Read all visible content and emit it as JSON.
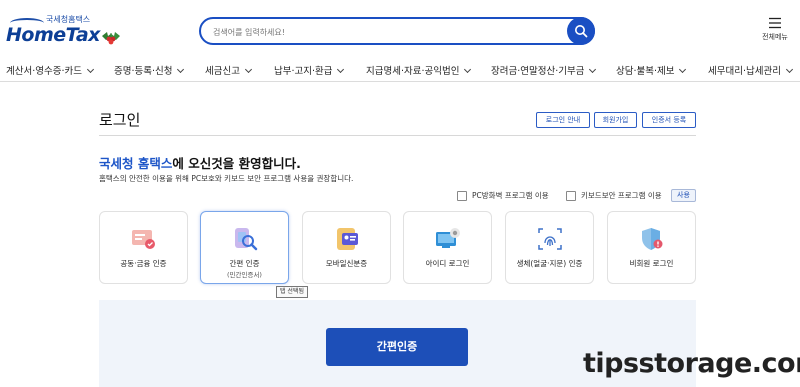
{
  "header": {
    "logo_sub": "국세청홈택스",
    "logo_main": "HomeTax",
    "search_placeholder": "검색어를 입력하세요!",
    "menu_label": "전체메뉴"
  },
  "nav": {
    "items": [
      {
        "label": "계산서·영수증·카드"
      },
      {
        "label": "증명·등록·신청"
      },
      {
        "label": "세금신고"
      },
      {
        "label": "납부·고지·환급"
      },
      {
        "label": "지급명세·자료·공익법인"
      },
      {
        "label": "장려금·연말정산·기부금"
      },
      {
        "label": "상담·불복·제보"
      },
      {
        "label": "세무대리·납세관리"
      }
    ]
  },
  "main": {
    "title": "로그인",
    "top_buttons": [
      {
        "label": "로그인 안내"
      },
      {
        "label": "회원가입"
      },
      {
        "label": "인증서 등록"
      }
    ],
    "welcome_highlight": "국세청 홈택스",
    "welcome_rest": "에 오신것을 환영합니다.",
    "welcome_sub": "홈택스의 안전한 이용을 위해 PC보호와 키보드 보안 프로그램 사용을 권장합니다.",
    "options": [
      {
        "label": "PC방화벽 프로그램 이용"
      },
      {
        "label": "키보드보안 프로그램 이용"
      }
    ],
    "use_button": "사용",
    "login_methods": [
      {
        "label": "공동·금융 인증",
        "sub": ""
      },
      {
        "label": "간편 인증",
        "sub": "(민간인증서)"
      },
      {
        "label": "모바일신분증",
        "sub": ""
      },
      {
        "label": "아이디 로그인",
        "sub": ""
      },
      {
        "label": "생체(얼굴·지문) 인증",
        "sub": ""
      },
      {
        "label": "비회원 로그인",
        "sub": ""
      }
    ],
    "tooltip": "탭 선택됨",
    "easy_login_button": "간편인증"
  },
  "watermark": "tipsstorage.com",
  "colors": {
    "brand": "#1a4fc3",
    "button": "#1d4fb8",
    "panel": "#f0f4fa",
    "highlight": "#1e56c8"
  }
}
